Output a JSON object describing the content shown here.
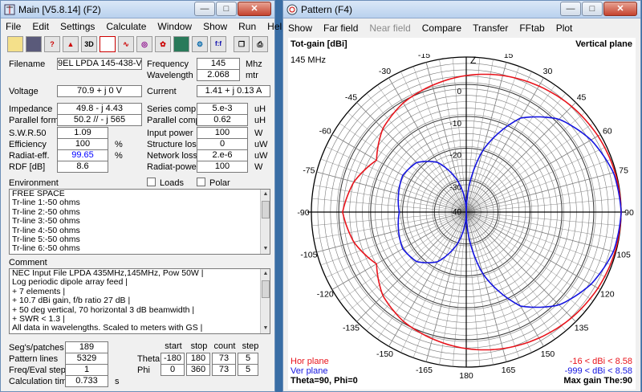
{
  "main": {
    "title": "Main [V5.8.14]  (F2)",
    "menu": [
      "File",
      "Edit",
      "Settings",
      "Calculate",
      "Window",
      "Show",
      "Run",
      "Help"
    ],
    "toolbar_icons": [
      "open-icon",
      "save-icon",
      "geometry-icon",
      "wires-icon",
      "3d-icon",
      "notepad-icon",
      "currents-icon",
      "sweep-icon",
      "pattern-icon",
      "calculator-icon",
      "optimize-icon",
      "ff-icon",
      "copy-icon",
      "print-icon"
    ],
    "toolbar_text": {
      "3d": "3D",
      "ff": "f:f"
    },
    "fields": {
      "filename_label": "Filename",
      "filename": "9EL LPDA 145-438-V",
      "frequency_label": "Frequency",
      "frequency": "145",
      "frequency_unit": "Mhz",
      "wavelength_label": "Wavelength",
      "wavelength": "2.068",
      "wavelength_unit": "mtr",
      "voltage_label": "Voltage",
      "voltage": "70.9 + j 0 V",
      "current_label": "Current",
      "current": "1.41 + j 0.13 A",
      "impedance_label": "Impedance",
      "impedance": "49.8 - j 4.43",
      "series_label": "Series comp.",
      "series": "5.e-3",
      "series_unit": "uH",
      "parallel_label": "Parallel form",
      "parallel": "50.2 // - j 565",
      "parcomp_label": "Parallel comp.",
      "parcomp": "0.62",
      "parcomp_unit": "uH",
      "swr_label": "S.W.R.50",
      "swr": "1.09",
      "inpower_label": "Input power",
      "inpower": "100",
      "inpower_unit": "W",
      "eff_label": "Efficiency",
      "eff": "100",
      "eff_unit": "%",
      "structloss_label": "Structure loss",
      "structloss": "0",
      "structloss_unit": "uW",
      "radeff_label": "Radiat-eff.",
      "radeff": "99.65",
      "radeff_unit": "%",
      "netloss_label": "Network loss",
      "netloss": "2.e-6",
      "netloss_unit": "uW",
      "rdf_label": "RDF [dB]",
      "rdf": "8.6",
      "radpower_label": "Radiat-power",
      "radpower": "100",
      "radpower_unit": "W"
    },
    "environment_label": "Environment",
    "loads_label": "Loads",
    "polar_label": "Polar",
    "environment_lines": [
      "FREE SPACE",
      "Tr-line  1:-50 ohms",
      "Tr-line  2:-50 ohms",
      "Tr-line  3:-50 ohms",
      "Tr-line  4:-50 ohms",
      "Tr-line  5:-50 ohms",
      "Tr-line  6:-50 ohms"
    ],
    "comment_label": "Comment",
    "comment_lines": [
      "NEC Input File LPDA 435MHz,145MHz, Pow 50W  |",
      "Log periodic dipole array feed                  |",
      "+ 7 elements           |",
      "+ 10.7 dBi gain, f/b ratio 27 dB             |",
      "+ 50 deg vertical, 70 horizontal 3 dB beamwidth |",
      "+ SWR < 1.3                       |",
      "All data in wavelengths. Scaled to meters with GS |"
    ],
    "bottom": {
      "segs_label": "Seg's/patches",
      "segs": "189",
      "patlines_label": "Pattern lines",
      "patlines": "5329",
      "freqsteps_label": "Freq/Eval steps",
      "freqsteps": "1",
      "calctime_label": "Calculation time",
      "calctime": "0.733",
      "calctime_unit": "s",
      "col_start": "start",
      "col_stop": "stop",
      "col_count": "count",
      "col_step": "step",
      "theta_label": "Theta",
      "theta": [
        "-180",
        "180",
        "73",
        "5"
      ],
      "phi_label": "Phi",
      "phi": [
        "0",
        "360",
        "73",
        "5"
      ]
    }
  },
  "pattern": {
    "title": "Pattern   (F4)",
    "menu": [
      {
        "label": "Show",
        "enabled": true
      },
      {
        "label": "Far field",
        "enabled": true
      },
      {
        "label": "Near field",
        "enabled": false
      },
      {
        "label": "Compare",
        "enabled": true
      },
      {
        "label": "Transfer",
        "enabled": true
      },
      {
        "label": "FFtab",
        "enabled": true
      },
      {
        "label": "Plot",
        "enabled": true
      }
    ],
    "top_left": "Tot-gain [dBi]",
    "top_right": "Vertical plane",
    "freq": "145 MHz",
    "z_label": "Z",
    "hor_label": "Hor plane",
    "ver_label": "Ver plane",
    "hor_range": "-16 < dBi < 8.58",
    "ver_range": "-999 < dBi < 8.58",
    "theta_phi": "Theta=90, Phi=0",
    "max_gain": "Max gain The:90",
    "ring_labels": [
      "-30",
      "-20",
      "-10",
      "0"
    ],
    "colors": {
      "hor": "#e8141c",
      "ver": "#1414e0",
      "grid": "#7a7a7a"
    }
  },
  "chart_data": {
    "type": "polar",
    "title": "",
    "angle_labels": [
      "0",
      "15",
      "30",
      "45",
      "60",
      "75",
      "90",
      "105",
      "120",
      "135",
      "150",
      "165",
      "180",
      "-165",
      "-150",
      "-135",
      "-120",
      "-105",
      "-90",
      "-75",
      "-60",
      "-45",
      "-30",
      "-15"
    ],
    "radial_labels": [
      "-30",
      "-20",
      "-10",
      "0"
    ],
    "radial_range_dbi": [
      -40,
      8.58
    ],
    "series": [
      {
        "name": "Hor plane",
        "color": "#e8141c",
        "angles": [
          0,
          15,
          30,
          45,
          60,
          75,
          90,
          105,
          120,
          135,
          150,
          165,
          180,
          -165,
          -150,
          -135,
          -120,
          -105,
          -90,
          -75,
          -60,
          -45,
          -30,
          -15
        ],
        "dbi": [
          2.8,
          4.3,
          5.6,
          6.8,
          7.7,
          8.3,
          8.58,
          8.3,
          7.7,
          6.8,
          5.6,
          4.3,
          2.8,
          1.1,
          -0.5,
          -3.0,
          -7.5,
          -3.5,
          -1.2,
          -3.5,
          -7.5,
          -3.0,
          -0.5,
          1.1
        ]
      },
      {
        "name": "Ver plane",
        "color": "#1414e0",
        "angles": [
          0,
          15,
          30,
          45,
          60,
          75,
          90,
          105,
          120,
          135,
          150,
          165,
          180,
          -165,
          -150,
          -135,
          -120,
          -105,
          -90,
          -75,
          -60,
          -45,
          -30,
          -15
        ],
        "dbi": [
          -999,
          -20.0,
          -6.0,
          1.2,
          5.2,
          7.8,
          8.58,
          7.8,
          5.2,
          1.2,
          -6.0,
          -20.0,
          -999,
          -30.0,
          -22.0,
          -18.0,
          -17.0,
          -18.0,
          -19.0,
          -18.0,
          -17.0,
          -18.0,
          -22.0,
          -30.0
        ]
      }
    ]
  }
}
